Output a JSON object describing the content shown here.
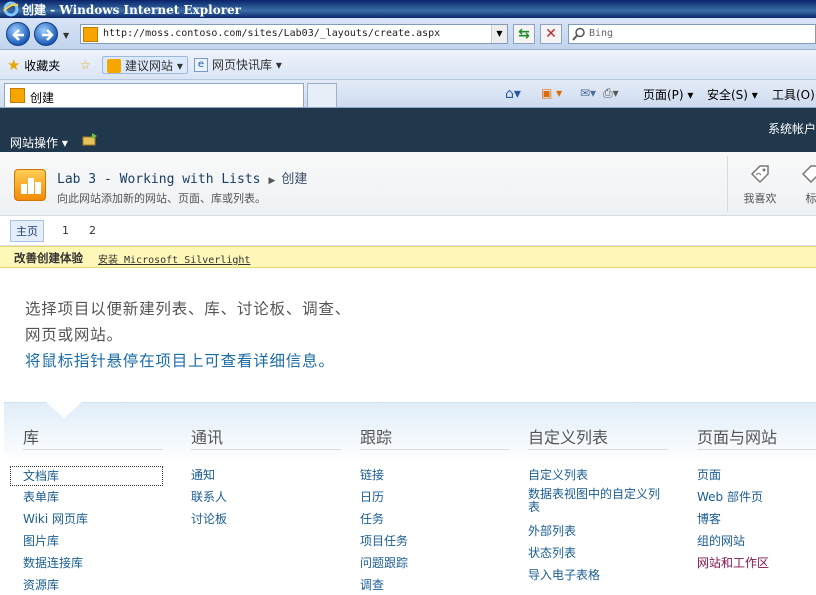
{
  "window": {
    "title": "创建 - Windows Internet Explorer"
  },
  "browser": {
    "url": "http://moss.contoso.com/sites/Lab03/_layouts/create.aspx",
    "search_placeholder": "Bing",
    "favorites_label": "收藏夹",
    "suggested_sites": "建议网站",
    "web_slice_gallery": "网页快讯库",
    "tab_title": "创建",
    "commands": {
      "page": "页面(P)",
      "safety": "安全(S)",
      "tools": "工具(O)"
    }
  },
  "sharepoint": {
    "site_actions": "网站操作",
    "account": "系统帐户",
    "breadcrumb_site": "Lab 3 - Working with Lists",
    "breadcrumb_page": "创建",
    "subtitle": "向此网站添加新的网站、页面、库或列表。",
    "social": {
      "like": "我喜欢",
      "tags": "标"
    },
    "page_tabs": [
      "主页",
      "1",
      "2"
    ],
    "silverlight": {
      "label": "改善创建体验",
      "link": "安装 Microsoft Silverlight"
    },
    "intro": {
      "line1": "选择项目以便新建列表、库、讨论板、调查、",
      "line2": "网页或网站。",
      "hint": "将鼠标指针悬停在项目上可查看详细信息。"
    },
    "categories": [
      {
        "title": "库",
        "items": [
          "文档库",
          "表单库",
          "Wiki 网页库",
          "图片库",
          "数据连接库",
          "资源库"
        ]
      },
      {
        "title": "通讯",
        "items": [
          "通知",
          "联系人",
          "讨论板"
        ]
      },
      {
        "title": "跟踪",
        "items": [
          "链接",
          "日历",
          "任务",
          "项目任务",
          "问题跟踪",
          "调查"
        ]
      },
      {
        "title": "自定义列表",
        "items": [
          "自定义列表",
          "数据表视图中的自定义列表",
          "外部列表",
          "状态列表",
          "导入电子表格"
        ]
      },
      {
        "title": "页面与网站",
        "items": [
          "页面",
          "Web 部件页",
          "博客",
          "组的网站",
          "网站和工作区"
        ]
      }
    ]
  }
}
